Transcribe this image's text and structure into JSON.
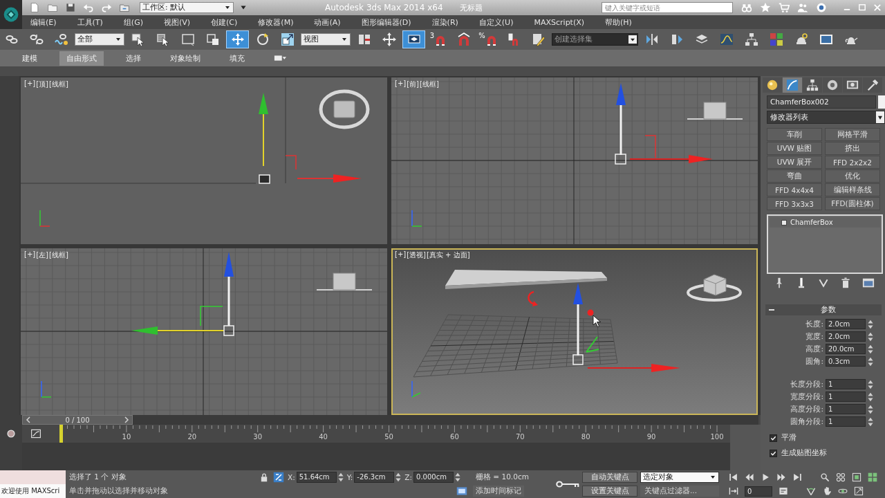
{
  "app": {
    "title": "Autodesk 3ds Max 2014 x64",
    "file_name": "无标题",
    "workspace": "工作区: 默认",
    "search": {
      "placeholder": "键入关键字或短语"
    }
  },
  "menu_bar": [
    "编辑(E)",
    "工具(T)",
    "组(G)",
    "视图(V)",
    "创建(C)",
    "修改器(M)",
    "动画(A)",
    "图形编辑器(D)",
    "渲染(R)",
    "自定义(U)",
    "MAXScript(X)",
    "帮助(H)"
  ],
  "main_toolbar": [
    {
      "kind": "link",
      "selected": false
    },
    {
      "kind": "unlink",
      "selected": false
    },
    {
      "kind": "bind",
      "selected": false
    },
    {
      "kind": "dropdown",
      "value": "全部"
    },
    {
      "kind": "select",
      "selected": false
    },
    {
      "kind": "select_by_name",
      "selected": false
    },
    {
      "kind": "rect_region",
      "selected": false
    },
    {
      "kind": "window_crossing",
      "selected": false
    },
    {
      "kind": "move",
      "selected": true
    },
    {
      "kind": "rotate",
      "selected": false
    },
    {
      "kind": "scale",
      "selected": false
    },
    {
      "kind": "dropdown",
      "value": "视图"
    },
    {
      "kind": "pivot",
      "selected": false
    },
    {
      "kind": "manipulate",
      "selected": false
    },
    {
      "kind": "shortcut",
      "selected": true
    },
    {
      "kind": "snap",
      "label": "3",
      "selected": false
    },
    {
      "kind": "angle_snap",
      "selected": false
    },
    {
      "kind": "snap",
      "label": "%",
      "selected": false
    },
    {
      "kind": "spinner_snap",
      "selected": false
    },
    {
      "kind": "edit_sets",
      "selected": false
    },
    {
      "kind": "dark_dropdown",
      "value": "创建选择集"
    },
    {
      "kind": "mirror",
      "selected": false
    },
    {
      "kind": "align",
      "selected": false
    },
    {
      "kind": "layers",
      "selected": false
    },
    {
      "kind": "curve_editor",
      "selected": false
    },
    {
      "kind": "schematic",
      "selected": false
    },
    {
      "kind": "material",
      "selected": false
    },
    {
      "kind": "render_setup",
      "selected": false
    },
    {
      "kind": "render_frame",
      "selected": false
    },
    {
      "kind": "render",
      "selected": false
    }
  ],
  "ribbon": {
    "tabs": [
      {
        "label": "建模",
        "selected": false
      },
      {
        "label": "自由形式",
        "selected": true
      },
      {
        "label": "选择",
        "selected": false
      },
      {
        "label": "对象绘制",
        "selected": false
      },
      {
        "label": "填充",
        "selected": false
      }
    ]
  },
  "viewports": [
    {
      "kind": "top",
      "labels": [
        "[+]",
        "[顶]",
        "[线框]"
      ],
      "active": false
    },
    {
      "kind": "front",
      "labels": [
        "[+]",
        "[前]",
        "[线框]"
      ],
      "active": false
    },
    {
      "kind": "left",
      "labels": [
        "[+]",
        "[左]",
        "[线框]"
      ],
      "active": false
    },
    {
      "kind": "perspective",
      "labels": [
        "[+]",
        "[透视]",
        "[真实 + 边面]"
      ],
      "active": true
    }
  ],
  "command_panel": {
    "tabs": [
      {
        "kind": "create",
        "selected": false
      },
      {
        "kind": "modify",
        "selected": true
      },
      {
        "kind": "hierarchy",
        "selected": false
      },
      {
        "kind": "motion",
        "selected": false
      },
      {
        "kind": "display",
        "selected": false
      },
      {
        "kind": "utilities",
        "selected": false
      }
    ],
    "object_name": "ChamferBox002",
    "modifier_list": "修改器列表",
    "modifier_buttons": [
      "车削",
      "网格平滑",
      "UVW 贴图",
      "挤出",
      "UVW 展开",
      "FFD 2x2x2",
      "弯曲",
      "优化",
      "FFD 4x4x4",
      "编辑样条线",
      "FFD 3x3x3",
      "FFD(圆柱体)"
    ],
    "stack": [
      {
        "label": "ChamferBox",
        "selected": false
      }
    ],
    "rollout": {
      "title": "参数",
      "expanded": true
    },
    "parameters": [
      {
        "label": "长度:",
        "value": "2.0cm"
      },
      {
        "label": "宽度:",
        "value": "2.0cm"
      },
      {
        "label": "高度:",
        "value": "20.0cm"
      },
      {
        "label": "圆角:",
        "value": "0.3cm"
      }
    ],
    "segments": [
      {
        "label": "长度分段:",
        "value": "1"
      },
      {
        "label": "宽度分段:",
        "value": "1"
      },
      {
        "label": "高度分段:",
        "value": "1"
      },
      {
        "label": "圆角分段:",
        "value": "1"
      }
    ],
    "options": [
      {
        "label": "平滑",
        "checked": true
      },
      {
        "label": "生成贴图坐标",
        "checked": true
      }
    ]
  },
  "timeline": {
    "time_slider": {
      "text": "0 / 100",
      "level": 0
    },
    "frame_labels": [
      "10",
      "20",
      "30",
      "40",
      "50",
      "60",
      "70",
      "80",
      "90",
      "100"
    ]
  },
  "status_bar": {
    "maxscript": "欢迎使用 MAXScri",
    "selection": "选择了 1 个 对象",
    "prompt": "单击并拖动以选择并移动对象",
    "coordinates": [
      {
        "axis": "X:",
        "value": "51.64cm"
      },
      {
        "axis": "Y:",
        "value": "-26.3cm"
      },
      {
        "axis": "Z:",
        "value": "0.000cm"
      }
    ],
    "grid": "栅格 = 10.0cm",
    "add_time_tag": "添加时间标记",
    "auto_key": {
      "label": "自动关键点",
      "on": false
    },
    "key_target": "选定对象",
    "set_key": "设置关键点",
    "key_filters": "关键点过滤器...",
    "frame": "0"
  }
}
